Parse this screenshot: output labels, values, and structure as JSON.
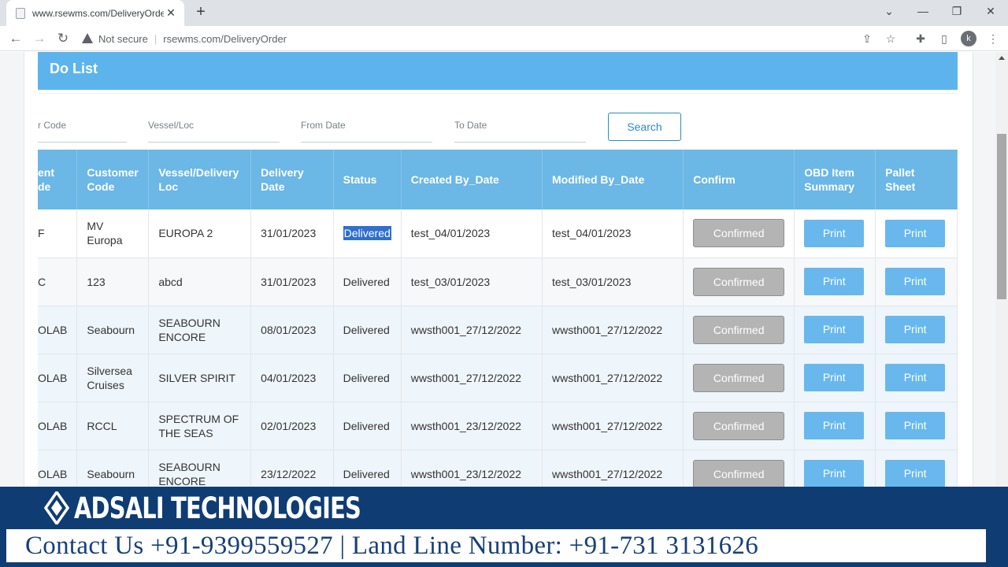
{
  "browser": {
    "tab_title": "www.rsewms.com/DeliveryOrder",
    "tab_close": "✕",
    "new_tab": "+",
    "window_controls": {
      "dropdown": "⌄",
      "minimize": "—",
      "restore": "❐",
      "close": "✕"
    },
    "nav": {
      "back": "←",
      "forward": "→",
      "reload": "↻"
    },
    "security_label": "Not secure",
    "separator": "|",
    "url": "rsewms.com/DeliveryOrder",
    "icons": {
      "share": "⇪",
      "bookmark": "☆",
      "extensions": "✚",
      "sidepanel": "▯",
      "menu": "⋮"
    },
    "profile_initial": "k"
  },
  "page": {
    "title": "Do List",
    "filters": [
      {
        "label": "r Code"
      },
      {
        "label": "Vessel/Loc"
      },
      {
        "label": "From Date"
      },
      {
        "label": "To Date"
      }
    ],
    "search_label": "Search"
  },
  "table": {
    "headers": {
      "client_code": "ent\nde",
      "customer_code": "Customer Code",
      "vessel_loc": "Vessel/Delivery Loc",
      "delivery_date": "Delivery Date",
      "status": "Status",
      "created": "Created By_Date",
      "modified": "Modified By_Date",
      "confirm": "Confirm",
      "obd": "OBD Item Summary",
      "pallet": "Pallet Sheet"
    },
    "rows": [
      {
        "client": "F",
        "customer": "MV Europa",
        "vessel": "EUROPA 2",
        "date": "31/01/2023",
        "status": "Delivered",
        "created": "test_04/01/2023",
        "modified": "test_04/01/2023",
        "confirm": "Confirmed",
        "obd": "Print",
        "pallet": "Print"
      },
      {
        "client": "C",
        "customer": "123",
        "vessel": "abcd",
        "date": "31/01/2023",
        "status": "Delivered",
        "created": "test_03/01/2023",
        "modified": "test_03/01/2023",
        "confirm": "Confirmed",
        "obd": "Print",
        "pallet": "Print"
      },
      {
        "client": "OLAB",
        "customer": "Seabourn",
        "vessel": "SEABOURN ENCORE",
        "date": "08/01/2023",
        "status": "Delivered",
        "created": "wwsth001_27/12/2022",
        "modified": "wwsth001_27/12/2022",
        "confirm": "Confirmed",
        "obd": "Print",
        "pallet": "Print"
      },
      {
        "client": "OLAB",
        "customer": "Silversea Cruises",
        "vessel": "SILVER SPIRIT",
        "date": "04/01/2023",
        "status": "Delivered",
        "created": "wwsth001_27/12/2022",
        "modified": "wwsth001_27/12/2022",
        "confirm": "Confirmed",
        "obd": "Print",
        "pallet": "Print"
      },
      {
        "client": "OLAB",
        "customer": "RCCL",
        "vessel": "SPECTRUM OF THE SEAS",
        "date": "02/01/2023",
        "status": "Delivered",
        "created": "wwsth001_23/12/2022",
        "modified": "wwsth001_27/12/2022",
        "confirm": "Confirmed",
        "obd": "Print",
        "pallet": "Print"
      },
      {
        "client": "OLAB",
        "customer": "Seabourn",
        "vessel": "SEABOURN ENCORE",
        "date": "23/12/2022",
        "status": "Delivered",
        "created": "wwsth001_23/12/2022",
        "modified": "wwsth001_27/12/2022",
        "confirm": "Confirmed",
        "obd": "Print",
        "pallet": "Print"
      }
    ]
  },
  "banner": {
    "company": "ADSALI TECHNOLOGIES",
    "contact": "Contact Us +91-9399559527 | Land Line Number: +91-731 3131626"
  },
  "colors": {
    "header_blue": "#5db4ec",
    "table_header": "#6bb7e6",
    "print_button": "#68b8ee",
    "confirmed_button": "#b4b4b4",
    "banner_navy": "#0f3c73"
  }
}
